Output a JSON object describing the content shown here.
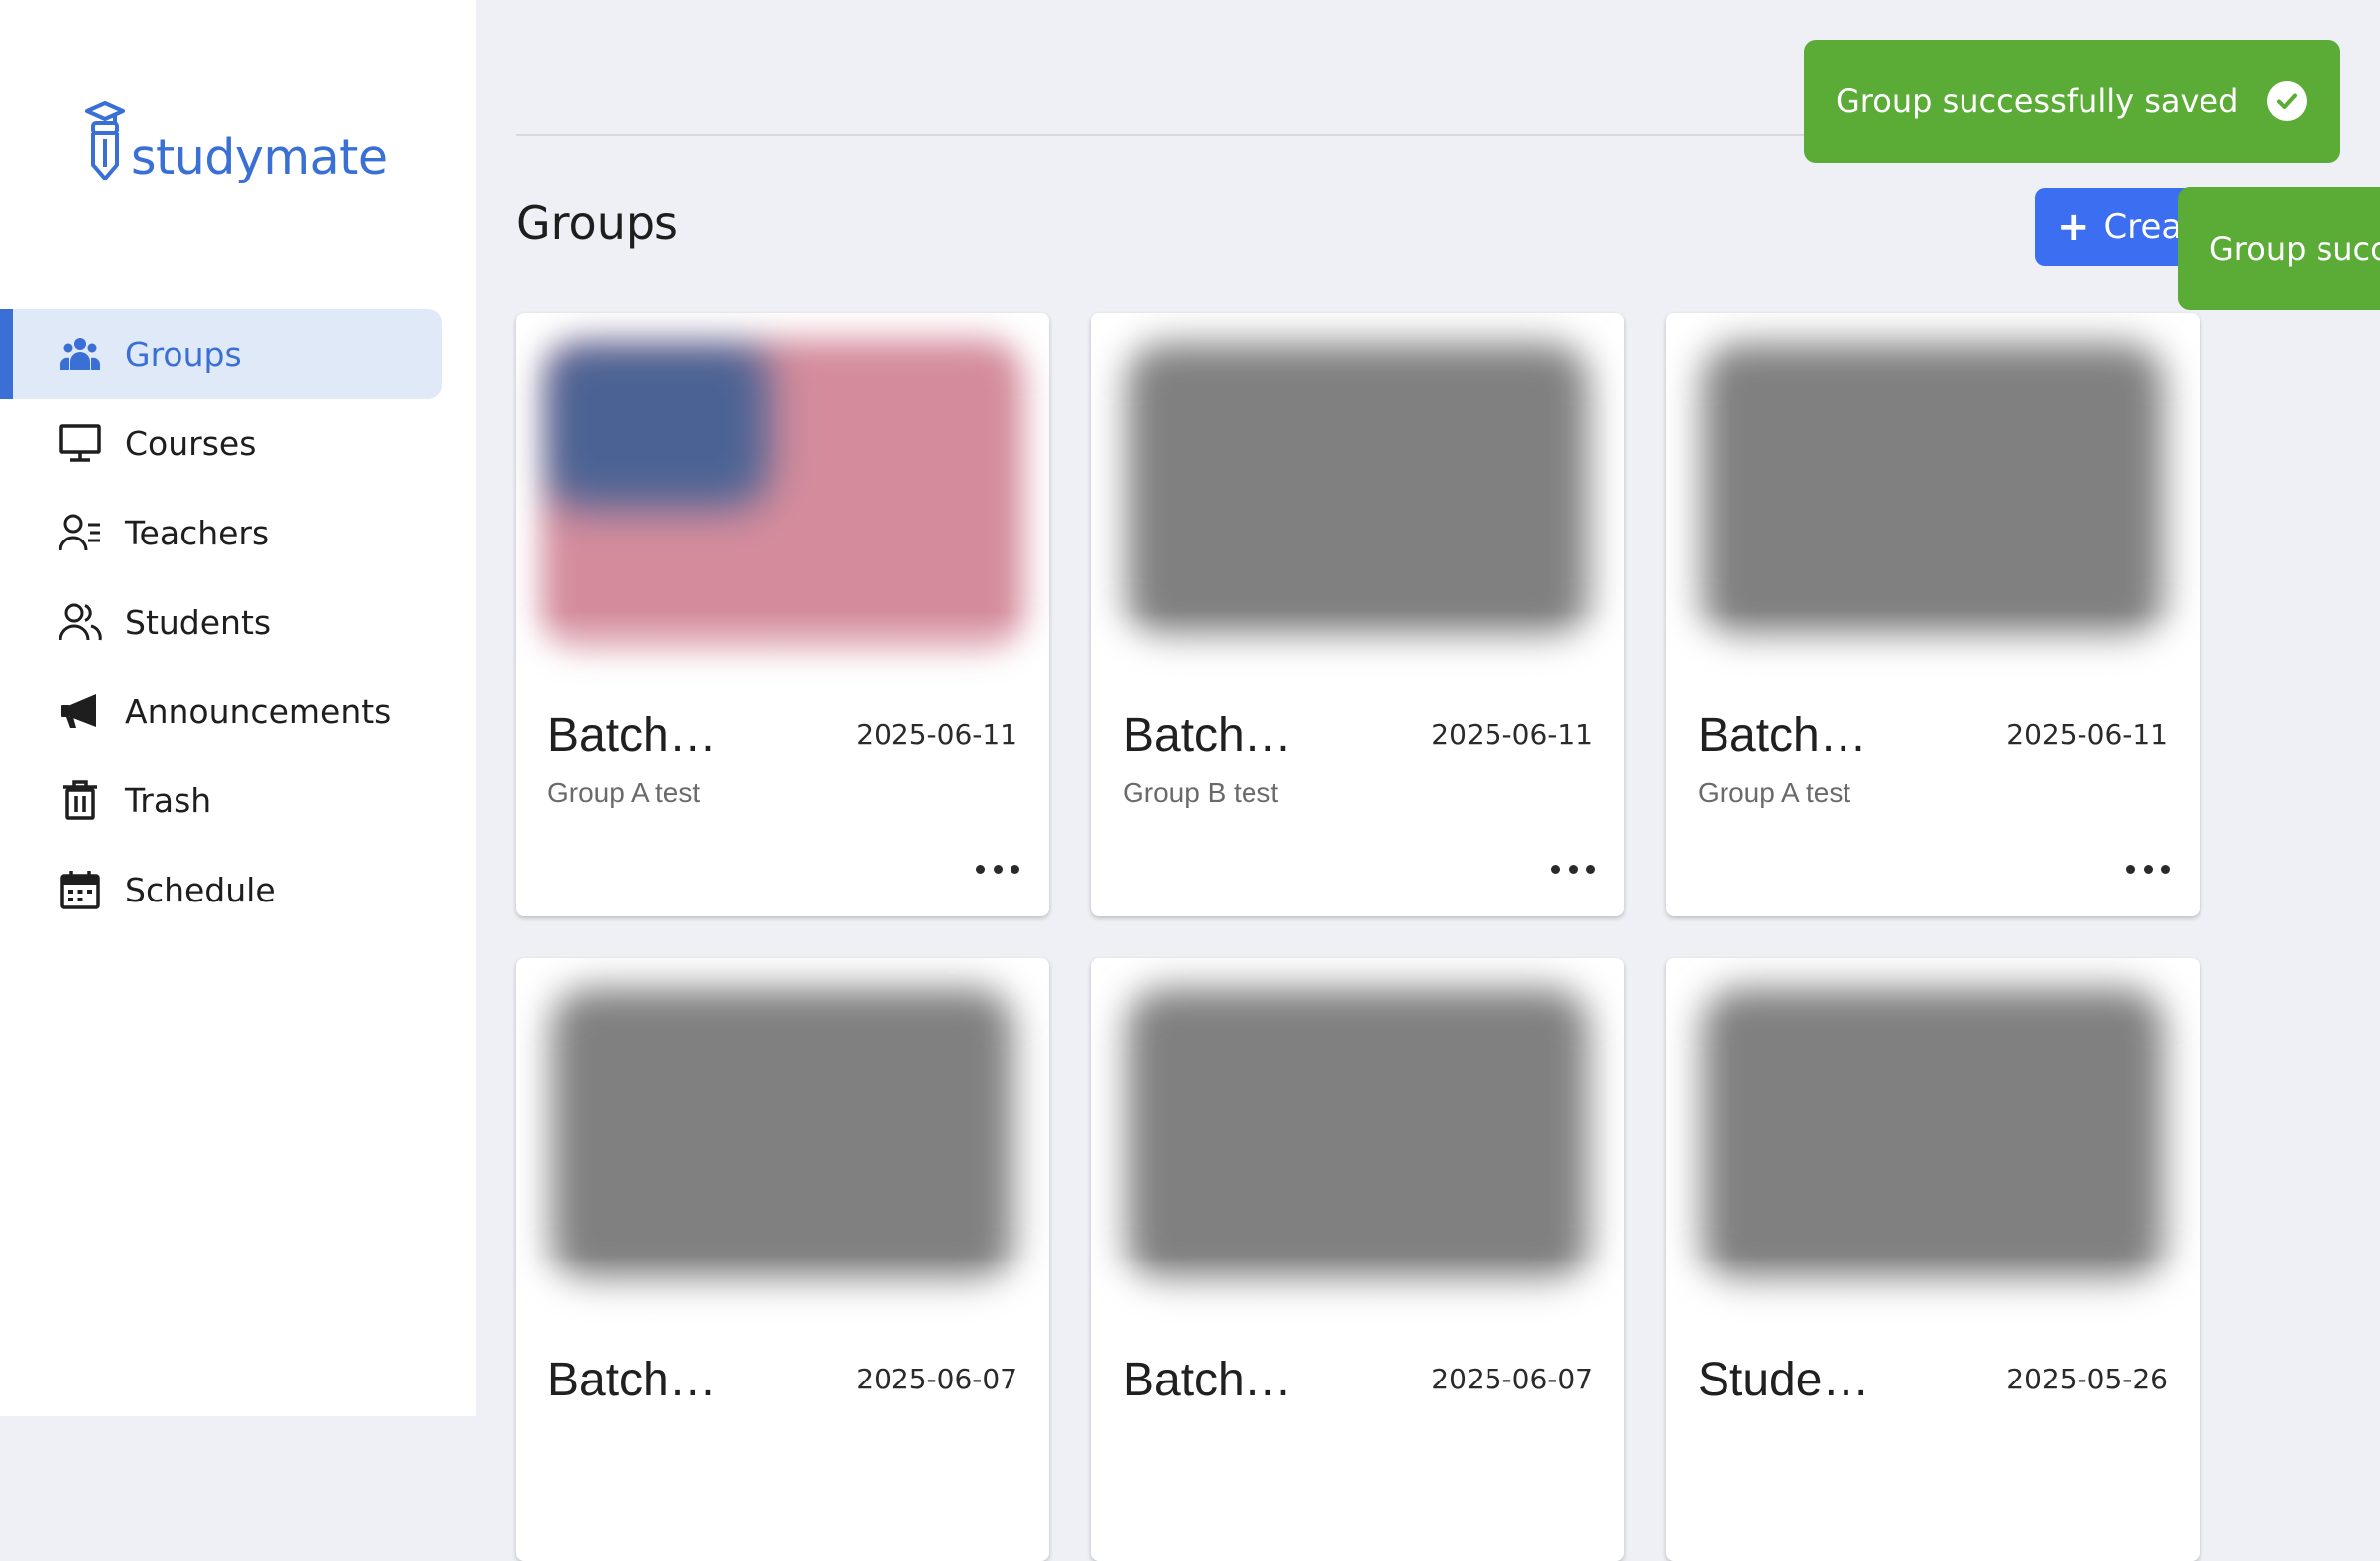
{
  "app": {
    "logo_text": "studymate"
  },
  "sidebar": {
    "items": [
      {
        "label": "Groups",
        "icon": "groups-icon",
        "active": true
      },
      {
        "label": "Courses",
        "icon": "monitor-icon",
        "active": false
      },
      {
        "label": "Teachers",
        "icon": "teacher-icon",
        "active": false
      },
      {
        "label": "Students",
        "icon": "students-icon",
        "active": false
      },
      {
        "label": "Announcements",
        "icon": "megaphone-icon",
        "active": false
      },
      {
        "label": "Trash",
        "icon": "trash-icon",
        "active": false
      },
      {
        "label": "Schedule",
        "icon": "calendar-icon",
        "active": false
      }
    ]
  },
  "main": {
    "title": "Groups",
    "create_button": {
      "label": "Creat"
    },
    "cards": [
      {
        "title": "Batch…",
        "date": "2025-06-11",
        "subtitle": "Group A test",
        "image": "flag"
      },
      {
        "title": "Batch…",
        "date": "2025-06-11",
        "subtitle": "Group B test",
        "image": "gray"
      },
      {
        "title": "Batch…",
        "date": "2025-06-11",
        "subtitle": "Group A test",
        "image": "gray"
      },
      {
        "title": "Batch…",
        "date": "2025-06-07",
        "subtitle": "",
        "image": "gray"
      },
      {
        "title": "Batch…",
        "date": "2025-06-07",
        "subtitle": "",
        "image": "gray"
      },
      {
        "title": "Student…",
        "date": "2025-05-26",
        "subtitle": "",
        "image": "gray"
      }
    ]
  },
  "toasts": [
    {
      "message": "Group successfully saved",
      "icon": "check-circle-icon"
    },
    {
      "message": "Group succ"
    }
  ],
  "colors": {
    "accent": "#3a6fd6",
    "button": "#3b6ef0",
    "toast": "#5bab37"
  }
}
